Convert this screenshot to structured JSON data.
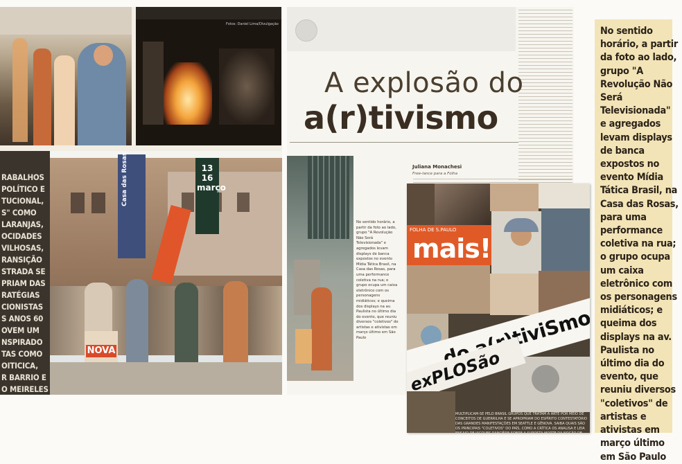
{
  "left_page": {
    "photo_credit": "Fotos: Daniel Lima/Divulgação",
    "body_fragment": [
      "RABALHOS",
      "POLÍTICO E",
      "TUCIONAL,",
      "S\" COMO",
      "LARANJAS,",
      "OCIDADES",
      "VILHOSAS,",
      "RANSIÇÃO",
      "STRADA SE",
      "PRIAM DAS",
      "RATÉGIAS",
      "CIONISTAS",
      "S ANOS 60",
      "OVEM UM",
      "NSPIRADO",
      "TAS COMO",
      "OITICICA,",
      "R BARRIO E",
      "O MEIRELES"
    ],
    "sign_text": "13 16 março",
    "sign_casa": "Casa das Rosas",
    "poster_text": "NOVA"
  },
  "middle_page": {
    "headline_line1": "A explosão do",
    "headline_line2": "a(r)tivismo",
    "byline": "Juliana Monachesi",
    "byline_sub": "Free-lance para a Folha",
    "caption_small": "No sentido horário, a partir da foto ao lado, grupo \"A Revolução Não Será Televisionada\" e agregados levam displays de banca expostos no evento Mídia Tática Brasil, na Casa das Rosas, para uma performance coletiva na rua; o grupo ocupa um caixa eletrônico com os personagens midiáticos; e queima dos displays na av. Paulista no último dia do evento, que reuniu diversos \"coletivos\" de artistas e ativistas em março último em São Paulo"
  },
  "mais_cover": {
    "paper_label": "FOLHA DE S.PAULO",
    "logo": "mais!",
    "banner_main": "do a(r)tiviSmo",
    "banner_second": "exPLOSão",
    "footer_text": "Multiplicam-se pelo Brasil grupos que tratam a arte por meio de conceitos de guerrilha e se apropriam do espírito contestatório das grandes manifestações em Seattle e Gênova. Saiba quais são os principais \"coletivos\" do país, como a crítica os analisa e leia ensaio de Jacques Rancière sobre a suposta morte da noção de autoria"
  },
  "right_caption": {
    "lines": [
      "No sentido",
      "horário, a partir",
      "da foto ao lado,",
      "grupo \"A",
      "Revolução Não",
      "Será",
      "Televisionada\"",
      "e agregados",
      "levam displays",
      "de banca",
      "expostos no",
      "evento Mídia",
      "Tática Brasil, na",
      "Casa das Rosas,",
      "para uma",
      "performance",
      "coletiva na rua;",
      "o grupo ocupa",
      "um caixa",
      "eletrônico com",
      "os personagens",
      "midiáticos; e",
      "queima dos",
      "displays na av.",
      "Paulista no",
      "último dia do",
      "evento, que",
      "reuniu diversos",
      "\"coletivos\" de",
      "artistas e",
      "ativistas em",
      "março último",
      "em São Paulo"
    ]
  },
  "colors": {
    "caption_bg": "#f2e4b7",
    "mais_orange": "#e05a28",
    "headline_dark": "#3a2e22",
    "sidebar_dark": "#3a342c"
  }
}
